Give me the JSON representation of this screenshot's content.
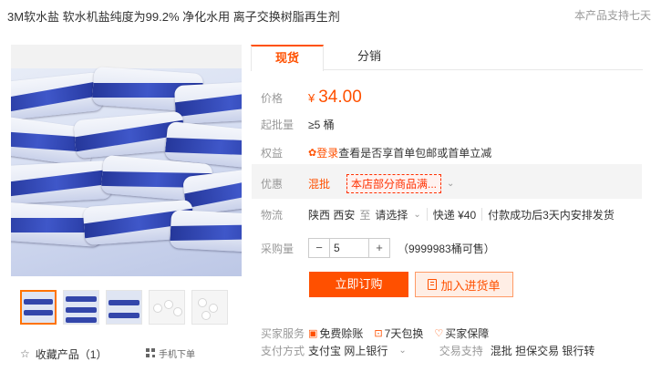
{
  "header": {
    "title": "3M软水盐 软水机盐纯度为99.2% 净化水用 离子交换树脂再生剂",
    "guarantee": "本产品支持七天"
  },
  "gallery": {
    "collect_label": "收藏产品（1）",
    "mobile_label": "手机下单"
  },
  "tabs": [
    {
      "label": "现货",
      "active": true
    },
    {
      "label": "分销",
      "active": false
    }
  ],
  "details": {
    "price": {
      "label": "价格",
      "currency": "¥",
      "value": "34.00"
    },
    "moq": {
      "label": "起批量",
      "value": "≥5 桶"
    },
    "rights": {
      "label": "权益",
      "link": "登录",
      "text": "查看是否享首单包邮或首单立减"
    },
    "promo": {
      "label": "优惠",
      "type": "混批",
      "tag": "本店部分商品满..."
    },
    "shipping": {
      "label": "物流",
      "from": "陕西 西安",
      "to_word": "至",
      "dest": "请选择",
      "express": "快递 ¥40",
      "dispatch": "付款成功后3天内安排发货"
    },
    "qty": {
      "label": "采购量",
      "value": "5",
      "minus": "−",
      "plus": "+",
      "stock": "（9999983桶可售）"
    }
  },
  "actions": {
    "order": "立即订购",
    "cart": "加入进货单"
  },
  "services": {
    "label": "买家服务",
    "items": [
      "免费赊账",
      "7天包换",
      "买家保障"
    ]
  },
  "payment": {
    "label": "支付方式",
    "methods": "支付宝  网上银行",
    "trade_label": "交易支持",
    "trade": "混批  担保交易  银行转"
  },
  "colors": {
    "accent": "#ff5000",
    "tag": "#ff3000"
  }
}
